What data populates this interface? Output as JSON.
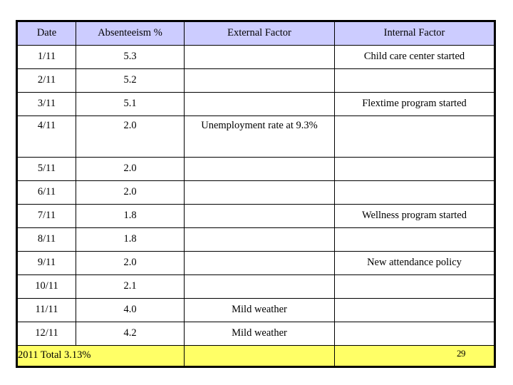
{
  "slide": {
    "page_number": "29"
  },
  "table": {
    "columns": [
      {
        "key": "date",
        "label": "Date"
      },
      {
        "key": "absent",
        "label": "Absenteeism %"
      },
      {
        "key": "external",
        "label": "External Factor"
      },
      {
        "key": "internal",
        "label": "Internal Factor"
      }
    ],
    "rows": [
      {
        "date": "1/11",
        "absent": "5.3",
        "external": "",
        "internal": "Child care center started",
        "tall": false
      },
      {
        "date": "2/11",
        "absent": "5.2",
        "external": "",
        "internal": "",
        "tall": false
      },
      {
        "date": "3/11",
        "absent": "5.1",
        "external": "",
        "internal": "Flextime program started",
        "tall": false
      },
      {
        "date": "4/11",
        "absent": "2.0",
        "external": "Unemployment rate at 9.3%",
        "internal": "",
        "tall": true
      },
      {
        "date": "5/11",
        "absent": "2.0",
        "external": "",
        "internal": "",
        "tall": false
      },
      {
        "date": "6/11",
        "absent": "2.0",
        "external": "",
        "internal": "",
        "tall": false
      },
      {
        "date": "7/11",
        "absent": "1.8",
        "external": "",
        "internal": "Wellness program started",
        "tall": false
      },
      {
        "date": "8/11",
        "absent": "1.8",
        "external": "",
        "internal": "",
        "tall": false
      },
      {
        "date": "9/11",
        "absent": "2.0",
        "external": "",
        "internal": "New attendance policy",
        "tall": false
      },
      {
        "date": "10/11",
        "absent": "2.1",
        "external": "",
        "internal": "",
        "tall": false
      },
      {
        "date": "11/11",
        "absent": "4.0",
        "external": "Mild weather",
        "internal": "",
        "tall": false
      },
      {
        "date": "12/11",
        "absent": "4.2",
        "external": "Mild weather",
        "internal": "",
        "tall": false
      }
    ],
    "total_row": {
      "label": "2011 Total 3.13%",
      "external": "",
      "internal": ""
    },
    "colors": {
      "header_fill": "#ccccff",
      "total_fill": "#ffff66",
      "border": "#000000",
      "body_fill": "#ffffff"
    }
  }
}
